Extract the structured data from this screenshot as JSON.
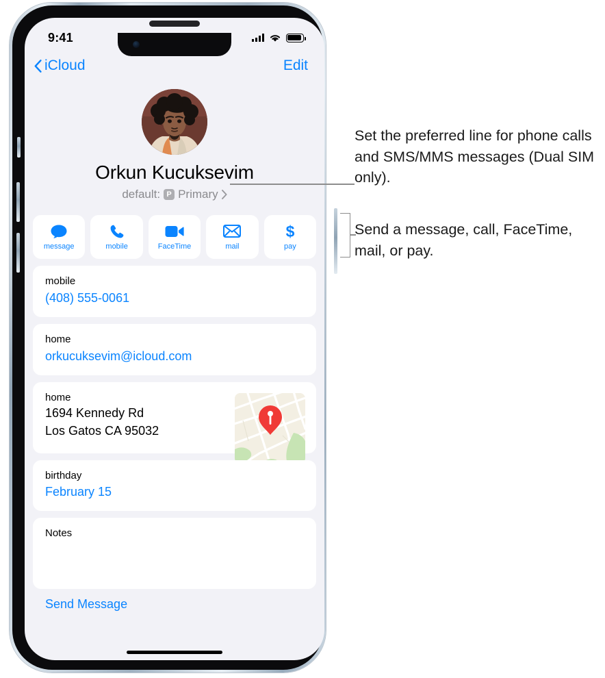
{
  "status_bar": {
    "time": "9:41",
    "cellular_icon": "cellular-signal-icon",
    "wifi_icon": "wifi-icon",
    "battery_icon": "battery-icon"
  },
  "nav_bar": {
    "back_label": "iCloud",
    "back_icon": "chevron-left-icon",
    "edit_label": "Edit"
  },
  "contact": {
    "avatar_name": "contact-avatar-photo",
    "name": "Orkun Kucuksevim",
    "default_prefix": "default:",
    "default_badge": "P",
    "default_value": "Primary",
    "default_chevron": "chevron-right-icon"
  },
  "actions": [
    {
      "label": "message",
      "icon": "message-bubble-icon"
    },
    {
      "label": "mobile",
      "icon": "phone-handset-icon"
    },
    {
      "label": "FaceTime",
      "icon": "video-camera-icon"
    },
    {
      "label": "mail",
      "icon": "envelope-icon"
    },
    {
      "label": "pay",
      "icon": "dollar-sign-icon"
    }
  ],
  "cards": {
    "phone": {
      "label": "mobile",
      "value": "(408) 555-0061"
    },
    "email": {
      "label": "home",
      "value": "orkucuksevim@icloud.com"
    },
    "address": {
      "label": "home",
      "line1": "1694 Kennedy Rd",
      "line2": "Los Gatos CA 95032",
      "map_icon": "map-thumbnail",
      "pin_icon": "map-pin-icon"
    },
    "birthday": {
      "label": "birthday",
      "value": "February 15"
    },
    "notes": {
      "label": "Notes"
    },
    "send_message": "Send Message"
  },
  "annotations": [
    "Set the preferred line for phone calls and SMS/MMS messages (Dual SIM only).",
    "Send a message, call, FaceTime, mail, or pay."
  ],
  "colors": {
    "accent_blue": "#0a84ff",
    "screen_bg": "#f2f2f7",
    "card_bg": "#ffffff",
    "secondary_text": "#8a8a8e",
    "map_pin": "#f03a36",
    "leader_gray": "#8d8d8d"
  }
}
